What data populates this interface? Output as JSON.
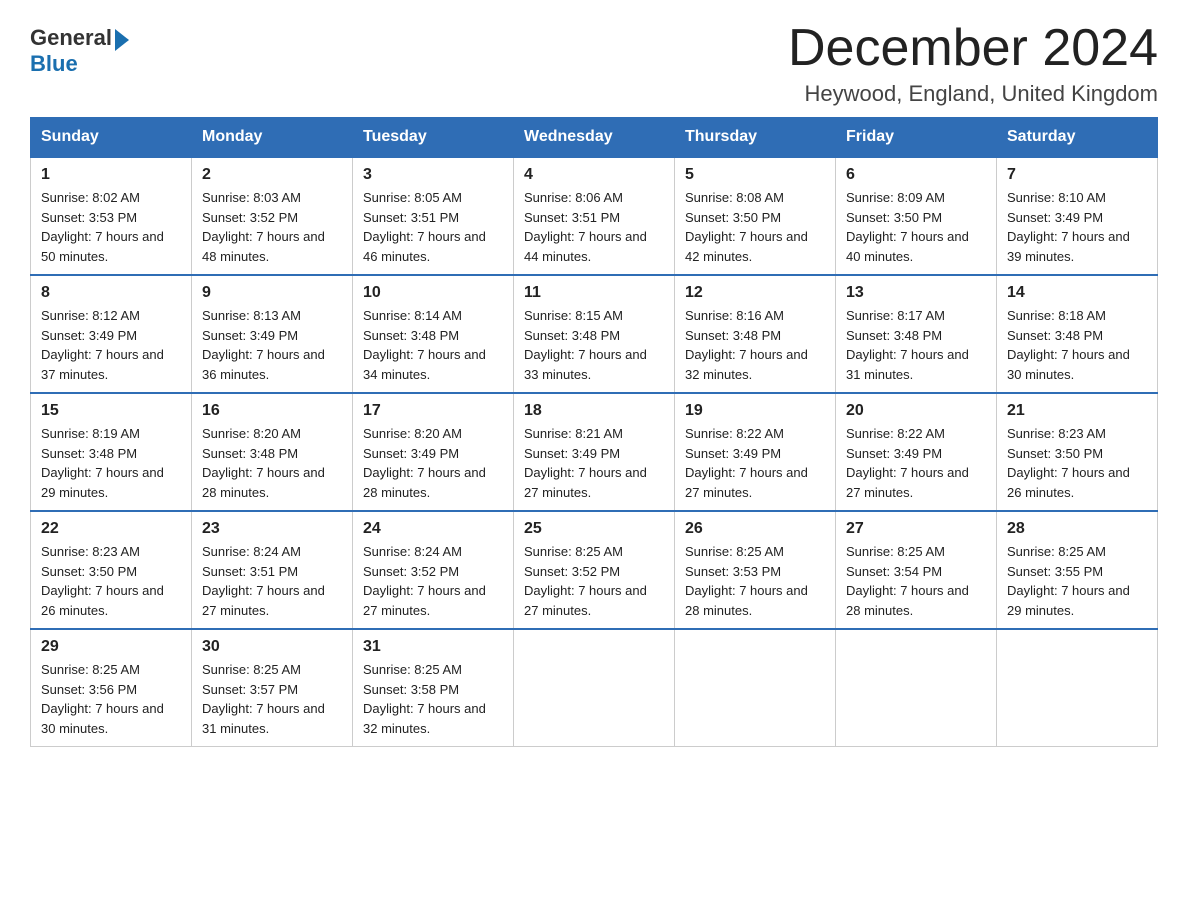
{
  "header": {
    "logo_general": "General",
    "logo_blue": "Blue",
    "title": "December 2024",
    "subtitle": "Heywood, England, United Kingdom"
  },
  "days_of_week": [
    "Sunday",
    "Monday",
    "Tuesday",
    "Wednesday",
    "Thursday",
    "Friday",
    "Saturday"
  ],
  "weeks": [
    [
      {
        "day": "1",
        "sunrise": "8:02 AM",
        "sunset": "3:53 PM",
        "daylight": "7 hours and 50 minutes."
      },
      {
        "day": "2",
        "sunrise": "8:03 AM",
        "sunset": "3:52 PM",
        "daylight": "7 hours and 48 minutes."
      },
      {
        "day": "3",
        "sunrise": "8:05 AM",
        "sunset": "3:51 PM",
        "daylight": "7 hours and 46 minutes."
      },
      {
        "day": "4",
        "sunrise": "8:06 AM",
        "sunset": "3:51 PM",
        "daylight": "7 hours and 44 minutes."
      },
      {
        "day": "5",
        "sunrise": "8:08 AM",
        "sunset": "3:50 PM",
        "daylight": "7 hours and 42 minutes."
      },
      {
        "day": "6",
        "sunrise": "8:09 AM",
        "sunset": "3:50 PM",
        "daylight": "7 hours and 40 minutes."
      },
      {
        "day": "7",
        "sunrise": "8:10 AM",
        "sunset": "3:49 PM",
        "daylight": "7 hours and 39 minutes."
      }
    ],
    [
      {
        "day": "8",
        "sunrise": "8:12 AM",
        "sunset": "3:49 PM",
        "daylight": "7 hours and 37 minutes."
      },
      {
        "day": "9",
        "sunrise": "8:13 AM",
        "sunset": "3:49 PM",
        "daylight": "7 hours and 36 minutes."
      },
      {
        "day": "10",
        "sunrise": "8:14 AM",
        "sunset": "3:48 PM",
        "daylight": "7 hours and 34 minutes."
      },
      {
        "day": "11",
        "sunrise": "8:15 AM",
        "sunset": "3:48 PM",
        "daylight": "7 hours and 33 minutes."
      },
      {
        "day": "12",
        "sunrise": "8:16 AM",
        "sunset": "3:48 PM",
        "daylight": "7 hours and 32 minutes."
      },
      {
        "day": "13",
        "sunrise": "8:17 AM",
        "sunset": "3:48 PM",
        "daylight": "7 hours and 31 minutes."
      },
      {
        "day": "14",
        "sunrise": "8:18 AM",
        "sunset": "3:48 PM",
        "daylight": "7 hours and 30 minutes."
      }
    ],
    [
      {
        "day": "15",
        "sunrise": "8:19 AM",
        "sunset": "3:48 PM",
        "daylight": "7 hours and 29 minutes."
      },
      {
        "day": "16",
        "sunrise": "8:20 AM",
        "sunset": "3:48 PM",
        "daylight": "7 hours and 28 minutes."
      },
      {
        "day": "17",
        "sunrise": "8:20 AM",
        "sunset": "3:49 PM",
        "daylight": "7 hours and 28 minutes."
      },
      {
        "day": "18",
        "sunrise": "8:21 AM",
        "sunset": "3:49 PM",
        "daylight": "7 hours and 27 minutes."
      },
      {
        "day": "19",
        "sunrise": "8:22 AM",
        "sunset": "3:49 PM",
        "daylight": "7 hours and 27 minutes."
      },
      {
        "day": "20",
        "sunrise": "8:22 AM",
        "sunset": "3:49 PM",
        "daylight": "7 hours and 27 minutes."
      },
      {
        "day": "21",
        "sunrise": "8:23 AM",
        "sunset": "3:50 PM",
        "daylight": "7 hours and 26 minutes."
      }
    ],
    [
      {
        "day": "22",
        "sunrise": "8:23 AM",
        "sunset": "3:50 PM",
        "daylight": "7 hours and 26 minutes."
      },
      {
        "day": "23",
        "sunrise": "8:24 AM",
        "sunset": "3:51 PM",
        "daylight": "7 hours and 27 minutes."
      },
      {
        "day": "24",
        "sunrise": "8:24 AM",
        "sunset": "3:52 PM",
        "daylight": "7 hours and 27 minutes."
      },
      {
        "day": "25",
        "sunrise": "8:25 AM",
        "sunset": "3:52 PM",
        "daylight": "7 hours and 27 minutes."
      },
      {
        "day": "26",
        "sunrise": "8:25 AM",
        "sunset": "3:53 PM",
        "daylight": "7 hours and 28 minutes."
      },
      {
        "day": "27",
        "sunrise": "8:25 AM",
        "sunset": "3:54 PM",
        "daylight": "7 hours and 28 minutes."
      },
      {
        "day": "28",
        "sunrise": "8:25 AM",
        "sunset": "3:55 PM",
        "daylight": "7 hours and 29 minutes."
      }
    ],
    [
      {
        "day": "29",
        "sunrise": "8:25 AM",
        "sunset": "3:56 PM",
        "daylight": "7 hours and 30 minutes."
      },
      {
        "day": "30",
        "sunrise": "8:25 AM",
        "sunset": "3:57 PM",
        "daylight": "7 hours and 31 minutes."
      },
      {
        "day": "31",
        "sunrise": "8:25 AM",
        "sunset": "3:58 PM",
        "daylight": "7 hours and 32 minutes."
      },
      null,
      null,
      null,
      null
    ]
  ]
}
